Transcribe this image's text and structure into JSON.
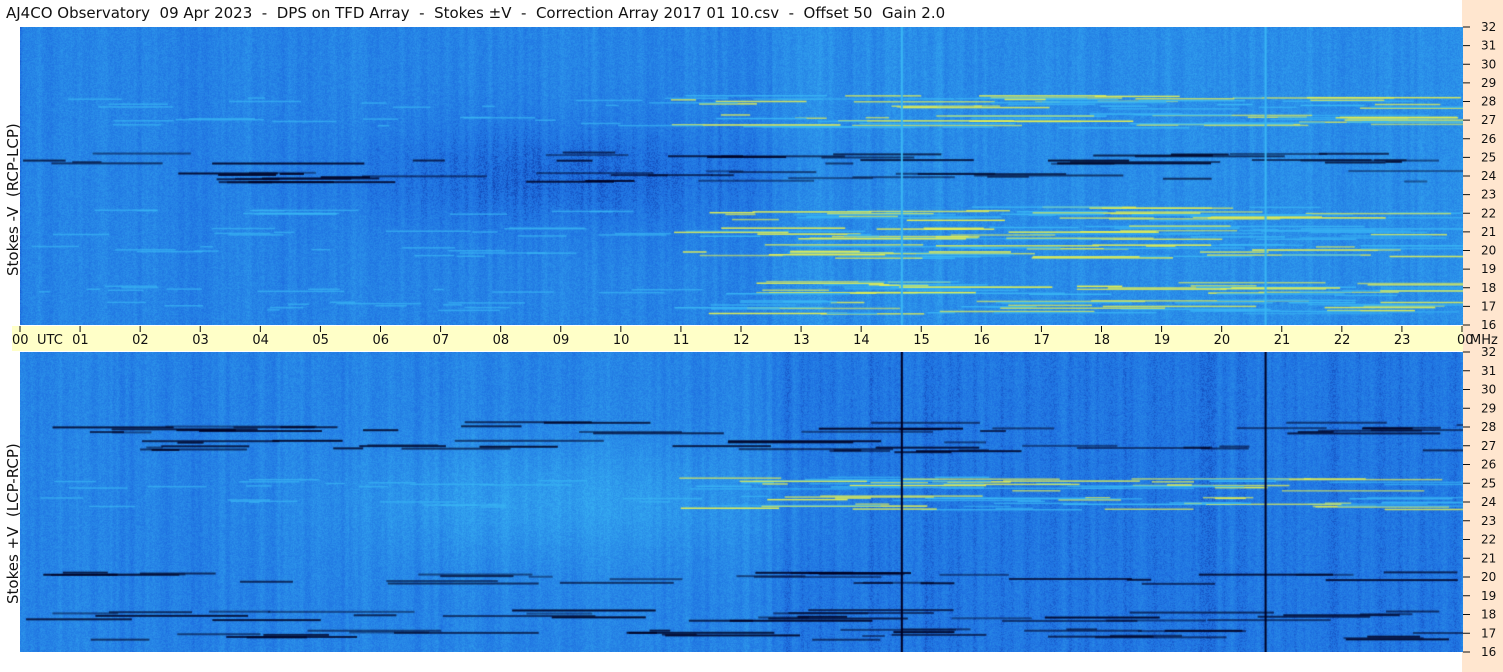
{
  "title": "AJ4CO Observatory  09 Apr 2023  -  DPS on TFD Array  -  Stokes ±V  -  Correction Array 2017 01 10.csv  -  Offset 50  Gain 2.0",
  "colors": {
    "frame_right": "#ffe6cf",
    "utc_band": "#ffffc8",
    "base_blue": "#1e6fe0",
    "dark_blue": "#0a2f9a",
    "light_blue": "#39b6f4",
    "yellow": "#e6f050",
    "black_line": "#000020"
  },
  "chart_data": [
    {
      "type": "heatmap",
      "name": "Stokes -V (RCP-LCP)",
      "ylabel": "Stokes -V  (RCP-LCP)",
      "yunit": "MHz",
      "ylim": [
        16,
        32
      ],
      "yticks": [
        "32",
        "31",
        "30",
        "29",
        "28",
        "27",
        "26",
        "25",
        "24",
        "23",
        "22",
        "21",
        "20",
        "19",
        "18",
        "17",
        "16"
      ],
      "xlim": [
        0,
        24
      ],
      "bright_frequencies": [
        28,
        27,
        22,
        21,
        20,
        18,
        17
      ],
      "dark_frequencies": [
        24,
        25
      ],
      "vertical_lines_utc": [
        14.65,
        20.7
      ]
    },
    {
      "type": "heatmap",
      "name": "Stokes +V (LCP-RCP)",
      "ylabel": "Stokes +V  (LCP-RCP)",
      "yunit": "MHz",
      "ylim": [
        16,
        32
      ],
      "yticks": [
        "32",
        "31",
        "30",
        "29",
        "28",
        "27",
        "26",
        "25",
        "24",
        "23",
        "22",
        "21",
        "20",
        "19",
        "18",
        "17",
        "16"
      ],
      "xlim": [
        0,
        24
      ],
      "dark_frequencies": [
        28,
        27,
        20,
        18,
        17
      ],
      "bright_frequencies": [
        25,
        24
      ],
      "vertical_lines_utc": [
        14.65,
        20.7
      ]
    }
  ],
  "utc_axis": {
    "labels": [
      "00",
      "01",
      "02",
      "03",
      "04",
      "05",
      "06",
      "07",
      "08",
      "09",
      "10",
      "11",
      "12",
      "13",
      "14",
      "15",
      "16",
      "17",
      "18",
      "19",
      "20",
      "21",
      "22",
      "23",
      "00"
    ],
    "utc_label": "UTC",
    "mhz_label": "MHz"
  }
}
